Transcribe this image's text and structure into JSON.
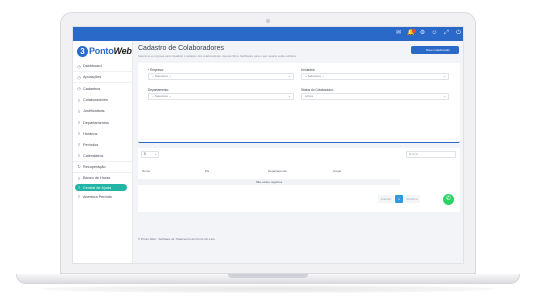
{
  "app": {
    "brand_prefix": "Ponto",
    "brand_suffix": "Web",
    "brand_mark": "3"
  },
  "colors": {
    "primary": "#2b69c9",
    "active_nav": "#22b5a5",
    "whatsapp": "#2bd466",
    "page_bg": "#f3f4f7"
  },
  "topbar": {
    "icons": [
      "mail-icon",
      "bell-icon",
      "gear-icon",
      "user-icon",
      "expand-icon",
      "power-icon"
    ]
  },
  "sidebar": {
    "items": [
      {
        "label": "Dashboard",
        "icon": "clock-icon"
      },
      {
        "label": "Apurações",
        "icon": "clock-icon"
      },
      {
        "label": "Cadastros",
        "icon": "clock-icon"
      },
      {
        "label": "Colaboradores",
        "icon": "list-icon"
      },
      {
        "label": "Justificativas",
        "icon": "list-icon"
      },
      {
        "label": "Departamentos",
        "icon": "list-icon"
      },
      {
        "label": "Horários",
        "icon": "list-icon"
      },
      {
        "label": "Períodos",
        "icon": "list-icon"
      },
      {
        "label": "Calendários",
        "icon": "list-icon"
      },
      {
        "label": "Recuperação",
        "icon": "refresh-icon"
      },
      {
        "label": "Banco de Horas",
        "icon": "list-icon"
      },
      {
        "label": "Central de Ajuda",
        "icon": "help-icon"
      },
      {
        "label": "Abertura Período",
        "icon": "list-icon"
      }
    ]
  },
  "page": {
    "title": "Cadastro de Colaboradores",
    "subtitle": "Selecione a empresa para visualizar o cadastro dos colaboradores. Apenas filtros habilitados para o seu usuário serão exibidos.",
    "new_button": "Novo Colaborador"
  },
  "filters": {
    "empresa_label": "* Empresa:",
    "empresa_value": "-- Selecione --",
    "unidades_label": "Unidades:",
    "unidades_value": "-- Selecione --",
    "departamento_label": "Departamento:",
    "departamento_value": "-- Selecione --",
    "status_label": "Status do Colaborador:",
    "status_value": "Ativos"
  },
  "table": {
    "page_size": "5",
    "search_placeholder": "Buscar:",
    "columns": [
      "Nome",
      "Pis",
      "Departamento",
      "Cargo"
    ],
    "empty_text": "Não existe registros",
    "prev_label": "Anterior",
    "current_page": "1",
    "next_label": "Próximo"
  },
  "footer": {
    "text": "© Ponto Web - Software de Tratamento de Ponto On-Line"
  }
}
